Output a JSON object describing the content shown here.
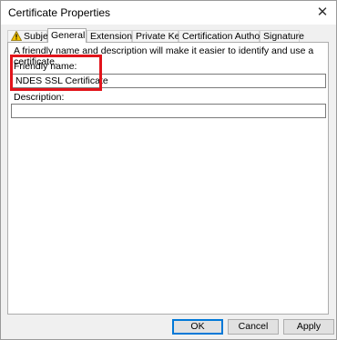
{
  "window": {
    "title": "Certificate Properties",
    "close_glyph": "✕"
  },
  "tabs": [
    {
      "label": "Subject",
      "has_warning_icon": true
    },
    {
      "label": "General",
      "active": true
    },
    {
      "label": "Extensions"
    },
    {
      "label": "Private Key"
    },
    {
      "label": "Certification Authority"
    },
    {
      "label": "Signature"
    }
  ],
  "general": {
    "intro_text": "A friendly name and description will make it easier to identify and use a certificate.",
    "friendly_name_label": "Friendly name:",
    "friendly_name_value": "NDES SSL Certificate",
    "description_label": "Description:",
    "description_value": ""
  },
  "buttons": {
    "ok": "OK",
    "cancel": "Cancel",
    "apply": "Apply"
  },
  "colors": {
    "highlight": "#e2141b",
    "default_button_border": "#0078d7",
    "warning_icon": "#f2c200"
  }
}
